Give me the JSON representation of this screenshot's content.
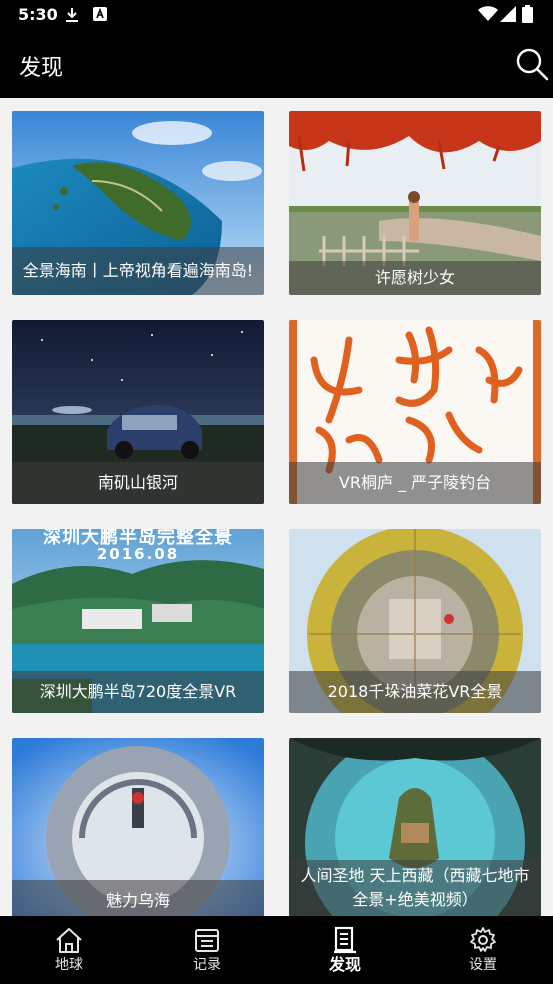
{
  "status_bar": {
    "time": "5:30"
  },
  "app_bar": {
    "title": "发现"
  },
  "cards": [
    {
      "caption": "全景海南丨上帝视角看遍海南岛!"
    },
    {
      "caption": "许愿树少女"
    },
    {
      "caption": "南矶山银河"
    },
    {
      "caption": "VR桐庐 _ 严子陵钓台"
    },
    {
      "caption": "深圳大鹏半岛720度全景VR"
    },
    {
      "caption": "2018千垛油菜花VR全景"
    },
    {
      "caption": "魅力乌海"
    },
    {
      "caption": "人间圣地 天上西藏（西藏七地市全景+绝美视频）"
    }
  ],
  "card_overlay_text": {
    "shenzhen_banner": "深圳大鹏半岛完整全景",
    "shenzhen_date": "2016.08"
  },
  "nav": [
    {
      "label": "地球",
      "icon": "home-icon"
    },
    {
      "label": "记录",
      "icon": "record-icon"
    },
    {
      "label": "发现",
      "icon": "discover-icon",
      "active": true
    },
    {
      "label": "设置",
      "icon": "settings-icon"
    }
  ]
}
